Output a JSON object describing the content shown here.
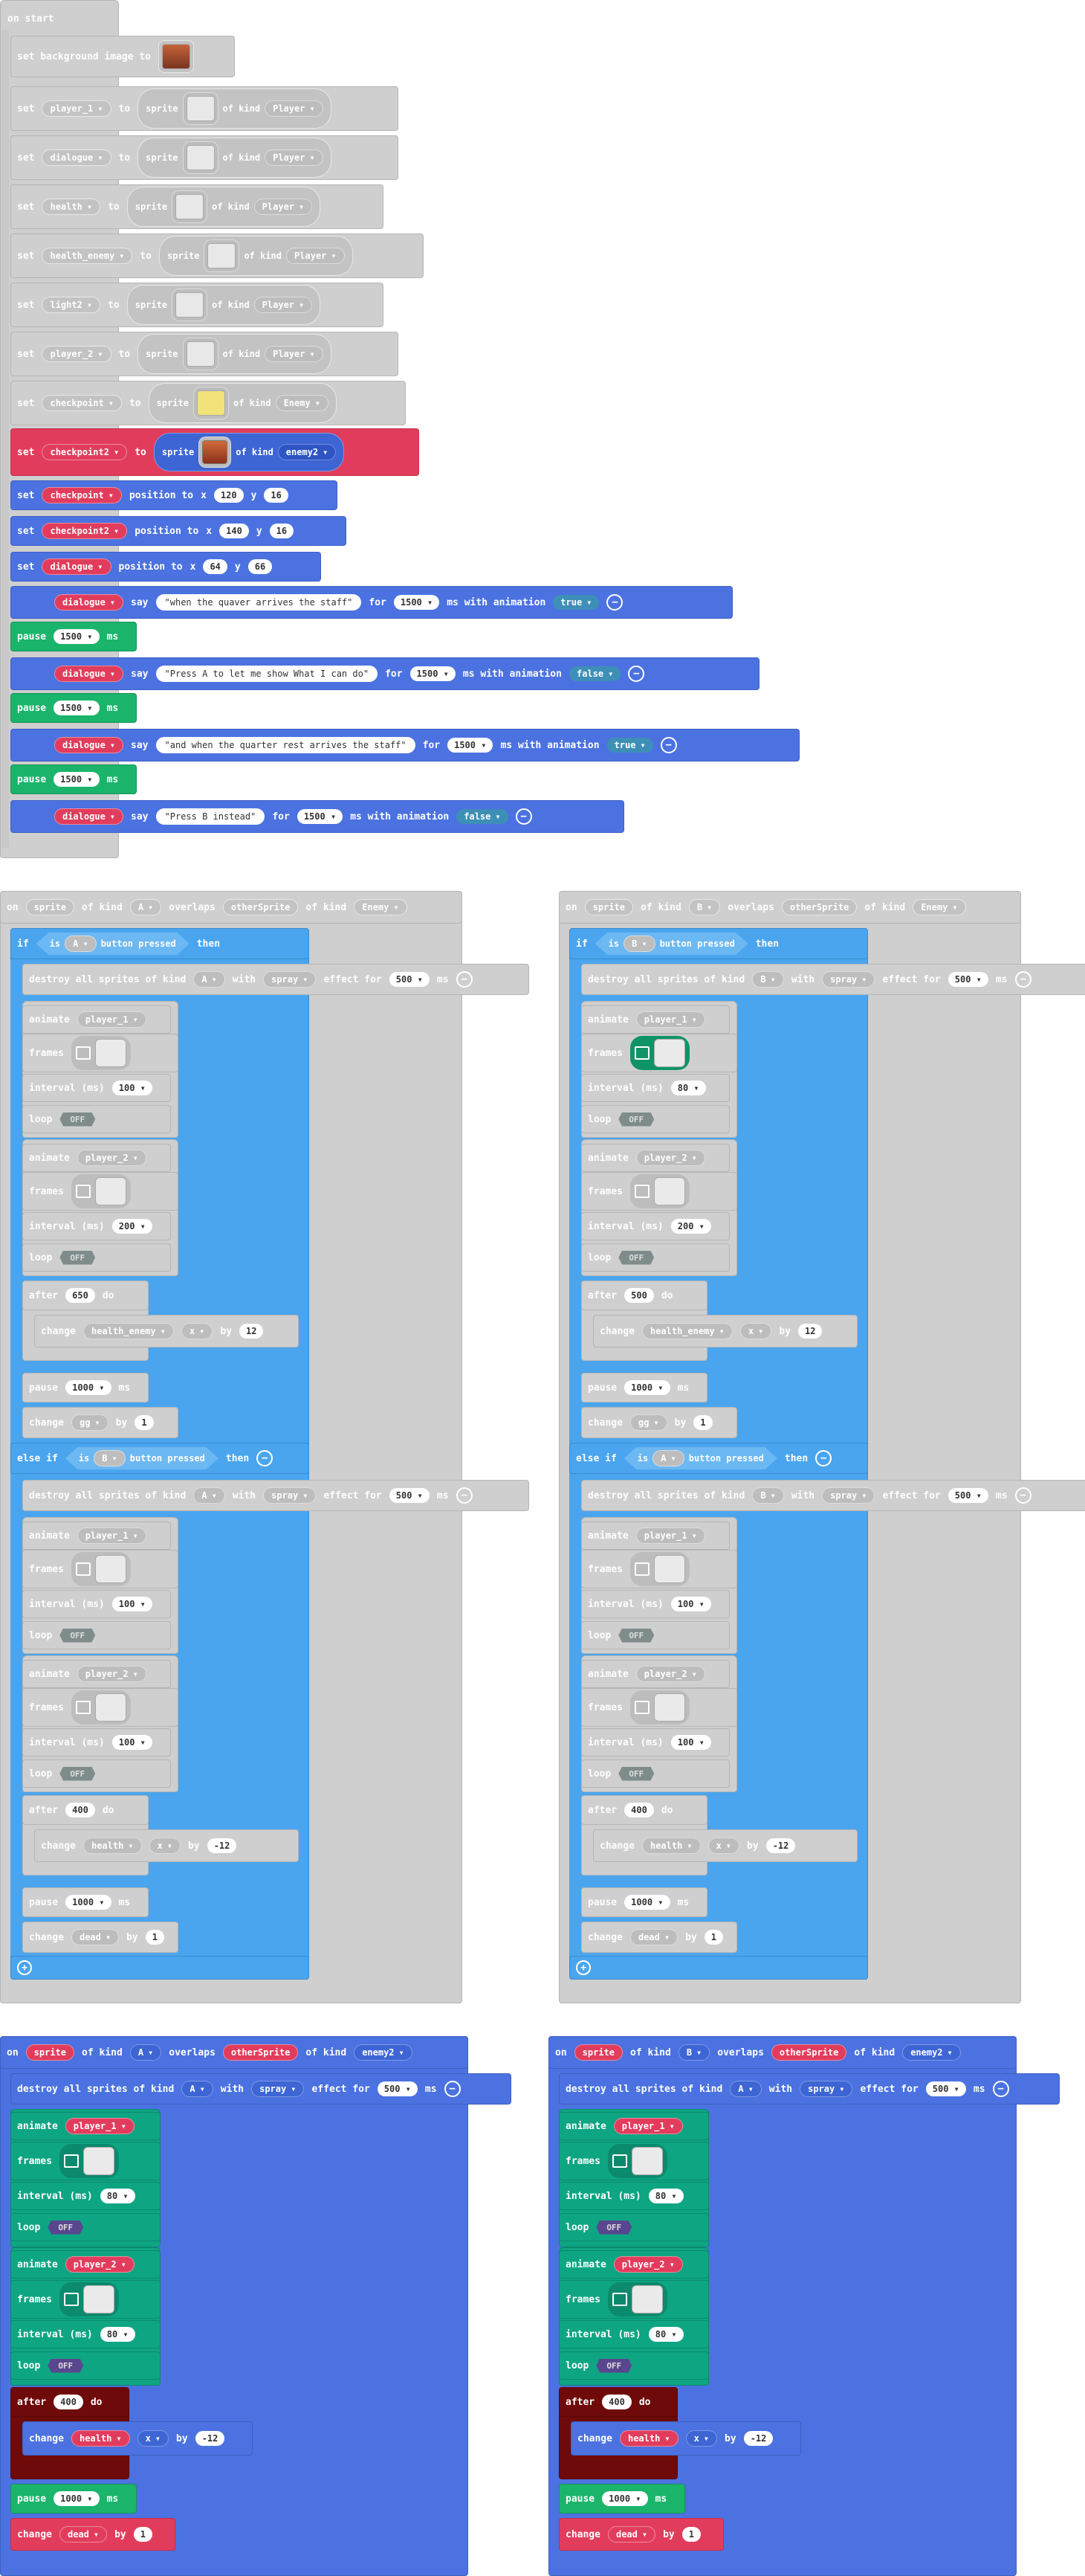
{
  "colors": {
    "events": "#4b72e0",
    "variables": "#e23c5c",
    "loops": "#1bb46b",
    "animation": "#0ea583",
    "logic": "#4aa5ee",
    "disabled": "#cfcfcf",
    "control": "#6f0a0a"
  },
  "on_start": {
    "label": "on start",
    "set_bg": {
      "kw": "set background image to",
      "thumb": "image-thumb-icon"
    },
    "sets": [
      {
        "set": "set",
        "var": "player_1",
        "to": "to",
        "sprite": "sprite",
        "ofkind": "of kind",
        "kind": "Player"
      },
      {
        "set": "set",
        "var": "dialogue",
        "to": "to",
        "sprite": "sprite",
        "ofkind": "of kind",
        "kind": "Player"
      },
      {
        "set": "set",
        "var": "health",
        "to": "to",
        "sprite": "sprite",
        "ofkind": "of kind",
        "kind": "Player"
      },
      {
        "set": "set",
        "var": "health_enemy",
        "to": "to",
        "sprite": "sprite",
        "ofkind": "of kind",
        "kind": "Player"
      },
      {
        "set": "set",
        "var": "light2",
        "to": "to",
        "sprite": "sprite",
        "ofkind": "of kind",
        "kind": "Player"
      },
      {
        "set": "set",
        "var": "player_2",
        "to": "to",
        "sprite": "sprite",
        "ofkind": "of kind",
        "kind": "Player"
      },
      {
        "set": "set",
        "var": "checkpoint",
        "to": "to",
        "sprite": "sprite",
        "ofkind": "of kind",
        "kind": "Enemy"
      }
    ],
    "set_cp2": {
      "set": "set",
      "var": "checkpoint2",
      "to": "to",
      "sprite": "sprite",
      "ofkind": "of kind",
      "kind": "enemy2"
    },
    "positions": [
      {
        "set": "set",
        "var": "checkpoint",
        "pos": "position to",
        "x": "x",
        "xv": "120",
        "y": "y",
        "yv": "16"
      },
      {
        "set": "set",
        "var": "checkpoint2",
        "pos": "position to",
        "x": "x",
        "xv": "140",
        "y": "y",
        "yv": "16"
      },
      {
        "set": "set",
        "var": "dialogue",
        "pos": "position to",
        "x": "x",
        "xv": "64",
        "y": "y",
        "yv": "66"
      }
    ],
    "says": [
      {
        "var": "dialogue",
        "say": "say",
        "text": "\"when the quaver arrives the staff\"",
        "for": "for",
        "ms": "1500",
        "msl": "ms with animation",
        "anim": "true"
      },
      {
        "var": "dialogue",
        "say": "say",
        "text": "\"Press A to let me show What I can do\"",
        "for": "for",
        "ms": "1500",
        "msl": "ms with animation",
        "anim": "false"
      },
      {
        "var": "dialogue",
        "say": "say",
        "text": "\"and when the quarter rest arrives the staff\"",
        "for": "for",
        "ms": "1500",
        "msl": "ms with animation",
        "anim": "true"
      },
      {
        "var": "dialogue",
        "say": "say",
        "text": "\"Press B instead\"",
        "for": "for",
        "ms": "1500",
        "msl": "ms with animation",
        "anim": "false"
      }
    ],
    "pause": {
      "kw": "pause",
      "val": "1500",
      "ms": "ms"
    }
  },
  "overlap_gray": [
    {
      "on": "on",
      "sprite": "sprite",
      "ofkind": "of kind",
      "btn": "A",
      "overlaps": "overlaps",
      "other": "otherSprite",
      "ofkind2": "of kind",
      "kind": "Enemy",
      "if": "if",
      "is": "is",
      "ifbtn": "A",
      "pressed": "button pressed",
      "then": "then",
      "destroy1": {
        "kw": "destroy all sprites of kind",
        "kind": "A",
        "with": "with",
        "effect": "spray",
        "efor": "effect for",
        "ms": "500",
        "msl": "ms"
      },
      "anim1": {
        "animate": "animate",
        "var": "player_1",
        "frames": "frames",
        "interval": "interval (ms)",
        "iv": "100",
        "loop": "loop",
        "off": "OFF"
      },
      "anim2": {
        "animate": "animate",
        "var": "player_2",
        "frames": "frames",
        "interval": "interval (ms)",
        "iv": "200",
        "loop": "loop",
        "off": "OFF"
      },
      "after1": {
        "after": "after",
        "val": "650",
        "do": "do",
        "change": "change",
        "var": "health_enemy",
        "axis": "x",
        "by": "by",
        "byv": "12"
      },
      "pause1": {
        "kw": "pause",
        "val": "1000",
        "ms": "ms"
      },
      "change1": {
        "kw": "change",
        "var": "gg",
        "by": "by",
        "val": "1"
      },
      "elseif": "else if",
      "eis": "is",
      "ebtn": "B",
      "epressed": "button pressed",
      "ethen": "then",
      "destroy2": {
        "kw": "destroy all sprites of kind",
        "kind": "A",
        "with": "with",
        "effect": "spray",
        "efor": "effect for",
        "ms": "500",
        "msl": "ms"
      },
      "anim3": {
        "animate": "animate",
        "var": "player_1",
        "frames": "frames",
        "interval": "interval (ms)",
        "iv": "100",
        "loop": "loop",
        "off": "OFF"
      },
      "anim4": {
        "animate": "animate",
        "var": "player_2",
        "frames": "frames",
        "interval": "interval (ms)",
        "iv": "100",
        "loop": "loop",
        "off": "OFF"
      },
      "after2": {
        "after": "after",
        "val": "400",
        "do": "do",
        "change": "change",
        "var": "health",
        "axis": "x",
        "by": "by",
        "byv": "-12"
      },
      "pause2": {
        "kw": "pause",
        "val": "1000",
        "ms": "ms"
      },
      "change2": {
        "kw": "change",
        "var": "dead",
        "by": "by",
        "val": "1"
      }
    },
    {
      "on": "on",
      "sprite": "sprite",
      "ofkind": "of kind",
      "btn": "B",
      "overlaps": "overlaps",
      "other": "otherSprite",
      "ofkind2": "of kind",
      "kind": "Enemy",
      "if": "if",
      "is": "is",
      "ifbtn": "B",
      "pressed": "button pressed",
      "then": "then",
      "destroy1": {
        "kw": "destroy all sprites of kind",
        "kind": "B",
        "with": "with",
        "effect": "spray",
        "efor": "effect for",
        "ms": "500",
        "msl": "ms"
      },
      "anim1": {
        "animate": "animate",
        "var": "player_1",
        "frames": "frames",
        "interval": "interval (ms)",
        "iv": "80",
        "loop": "loop",
        "off": "OFF"
      },
      "anim2": {
        "animate": "animate",
        "var": "player_2",
        "frames": "frames",
        "interval": "interval (ms)",
        "iv": "200",
        "loop": "loop",
        "off": "OFF"
      },
      "after1": {
        "after": "after",
        "val": "500",
        "do": "do",
        "change": "change",
        "var": "health_enemy",
        "axis": "x",
        "by": "by",
        "byv": "12"
      },
      "pause1": {
        "kw": "pause",
        "val": "1000",
        "ms": "ms"
      },
      "change1": {
        "kw": "change",
        "var": "gg",
        "by": "by",
        "val": "1"
      },
      "elseif": "else if",
      "eis": "is",
      "ebtn": "A",
      "epressed": "button pressed",
      "ethen": "then",
      "destroy2": {
        "kw": "destroy all sprites of kind",
        "kind": "B",
        "with": "with",
        "effect": "spray",
        "efor": "effect for",
        "ms": "500",
        "msl": "ms"
      },
      "anim3": {
        "animate": "animate",
        "var": "player_1",
        "frames": "frames",
        "interval": "interval (ms)",
        "iv": "100",
        "loop": "loop",
        "off": "OFF"
      },
      "anim4": {
        "animate": "animate",
        "var": "player_2",
        "frames": "frames",
        "interval": "interval (ms)",
        "iv": "100",
        "loop": "loop",
        "off": "OFF"
      },
      "after2": {
        "after": "after",
        "val": "400",
        "do": "do",
        "change": "change",
        "var": "health",
        "axis": "x",
        "by": "by",
        "byv": "-12"
      },
      "pause2": {
        "kw": "pause",
        "val": "1000",
        "ms": "ms"
      },
      "change2": {
        "kw": "change",
        "var": "dead",
        "by": "by",
        "val": "1"
      }
    }
  ],
  "overlap_color": [
    {
      "on": "on",
      "sprite": "sprite",
      "ofkind": "of kind",
      "btn": "A",
      "overlaps": "overlaps",
      "other": "otherSprite",
      "ofkind2": "of kind",
      "kind": "enemy2",
      "destroy": {
        "kw": "destroy all sprites of kind",
        "kind": "A",
        "with": "with",
        "effect": "spray",
        "efor": "effect for",
        "ms": "500",
        "msl": "ms"
      },
      "anim1": {
        "animate": "animate",
        "var": "player_1",
        "frames": "frames",
        "interval": "interval (ms)",
        "iv": "80",
        "loop": "loop",
        "off": "OFF"
      },
      "anim2": {
        "animate": "animate",
        "var": "player_2",
        "frames": "frames",
        "interval": "interval (ms)",
        "iv": "80",
        "loop": "loop",
        "off": "OFF"
      },
      "after": {
        "after": "after",
        "val": "400",
        "do": "do",
        "change": "change",
        "var": "health",
        "axis": "x",
        "by": "by",
        "byv": "-12"
      },
      "pause": {
        "kw": "pause",
        "val": "1000",
        "ms": "ms"
      },
      "change": {
        "kw": "change",
        "var": "dead",
        "by": "by",
        "val": "1"
      }
    },
    {
      "on": "on",
      "sprite": "sprite",
      "ofkind": "of kind",
      "btn": "B",
      "overlaps": "overlaps",
      "other": "otherSprite",
      "ofkind2": "of kind",
      "kind": "enemy2",
      "destroy": {
        "kw": "destroy all sprites of kind",
        "kind": "A",
        "with": "with",
        "effect": "spray",
        "efor": "effect for",
        "ms": "500",
        "msl": "ms"
      },
      "anim1": {
        "animate": "animate",
        "var": "player_1",
        "frames": "frames",
        "interval": "interval (ms)",
        "iv": "80",
        "loop": "loop",
        "off": "OFF"
      },
      "anim2": {
        "animate": "animate",
        "var": "player_2",
        "frames": "frames",
        "interval": "interval (ms)",
        "iv": "80",
        "loop": "loop",
        "off": "OFF"
      },
      "after": {
        "after": "after",
        "val": "400",
        "do": "do",
        "change": "change",
        "var": "health",
        "axis": "x",
        "by": "by",
        "byv": "-12"
      },
      "pause": {
        "kw": "pause",
        "val": "1000",
        "ms": "ms"
      },
      "change": {
        "kw": "change",
        "var": "dead",
        "by": "by",
        "val": "1"
      }
    }
  ]
}
